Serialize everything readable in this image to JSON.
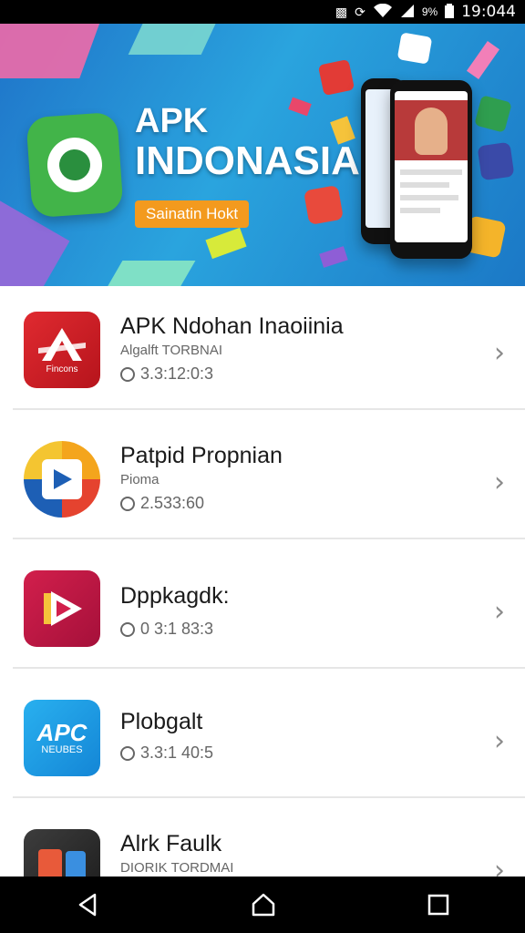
{
  "status_bar": {
    "battery": "9%",
    "time": "19:044"
  },
  "banner": {
    "title_line1": "APK",
    "title_line2": "INDONASIA",
    "tag": "Sainatin Hokt"
  },
  "apps": [
    {
      "name": "APK Ndohan Inaoiinia",
      "subtitle": "Algalft TORBNAI",
      "meta": "3.3:12:0:3",
      "icon_text": "Fincons",
      "icon_color": "#d8232a"
    },
    {
      "name": "Patpid Propnian",
      "subtitle": "Pioma",
      "meta": "2.533:60",
      "icon_text": "",
      "icon_color": "#1d5fb5"
    },
    {
      "name": "Dppkagdk:",
      "subtitle": "",
      "meta": "0 3:1 83:3",
      "icon_text": "",
      "icon_color": "#c6174a"
    },
    {
      "name": "Plobgalt",
      "subtitle": "",
      "meta": "3.3:1 40:5",
      "icon_text": "APC",
      "icon_sub": "NEUBES",
      "icon_color": "#1a9be2"
    },
    {
      "name": "Alrk Faulk",
      "subtitle": "DIORIK TORDMAI",
      "meta": "",
      "icon_text": "",
      "icon_color": "#333333"
    }
  ],
  "nav": {
    "back": "back-icon",
    "home": "home-icon",
    "recents": "recents-icon"
  }
}
